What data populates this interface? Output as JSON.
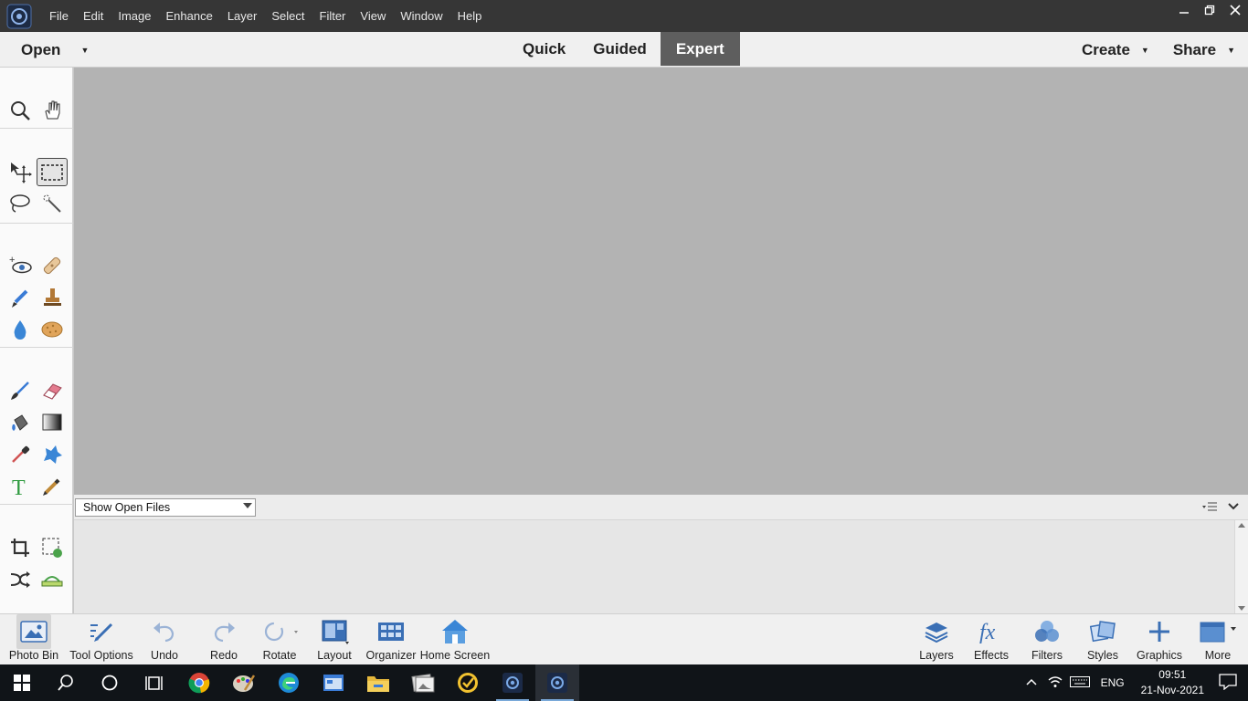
{
  "menubar": {
    "items": [
      "File",
      "Edit",
      "Image",
      "Enhance",
      "Layer",
      "Select",
      "Filter",
      "View",
      "Window",
      "Help"
    ]
  },
  "modebar": {
    "open_label": "Open",
    "tabs": [
      "Quick",
      "Guided",
      "Expert"
    ],
    "active_tab": "Expert",
    "create_label": "Create",
    "share_label": "Share"
  },
  "toolbox": {
    "tools": [
      "zoom-tool",
      "hand-tool",
      "move-tool",
      "rectangular-marquee-tool",
      "lasso-tool",
      "quick-selection-tool",
      "red-eye-removal-tool",
      "spot-healing-brush-tool",
      "smart-brush-tool",
      "clone-stamp-tool",
      "blur-tool",
      "sponge-tool",
      "brush-tool",
      "eraser-tool",
      "paint-bucket-tool",
      "gradient-tool",
      "eyedropper-tool",
      "custom-shape-tool",
      "type-tool",
      "pencil-tool",
      "crop-tool",
      "recompose-tool",
      "content-aware-move-tool",
      "straighten-tool"
    ],
    "selected": "rectangular-marquee-tool"
  },
  "bin": {
    "select_value": "Show Open Files"
  },
  "bottom_bar": {
    "left": [
      {
        "label": "Photo Bin",
        "icon": "photo-bin-icon"
      },
      {
        "label": "Tool Options",
        "icon": "tool-options-icon"
      },
      {
        "label": "Undo",
        "icon": "undo-icon"
      },
      {
        "label": "Redo",
        "icon": "redo-icon"
      },
      {
        "label": "Rotate",
        "icon": "rotate-icon"
      },
      {
        "label": "Layout",
        "icon": "layout-icon"
      },
      {
        "label": "Organizer",
        "icon": "organizer-icon"
      },
      {
        "label": "Home Screen",
        "icon": "home-icon"
      }
    ],
    "right": [
      {
        "label": "Layers",
        "icon": "layers-icon"
      },
      {
        "label": "Effects",
        "icon": "fx-icon"
      },
      {
        "label": "Filters",
        "icon": "filters-icon"
      },
      {
        "label": "Styles",
        "icon": "styles-icon"
      },
      {
        "label": "Graphics",
        "icon": "plus-icon"
      },
      {
        "label": "More",
        "icon": "more-icon"
      }
    ]
  },
  "windows_taskbar": {
    "language": "ENG",
    "time": "09:51",
    "date": "21-Nov-2021"
  },
  "colors": {
    "menubar_bg": "#363636",
    "canvas_bg": "#b3b3b3",
    "active_tab_bg": "#5e5e5e",
    "icon_blue": "#3a7bd5"
  }
}
